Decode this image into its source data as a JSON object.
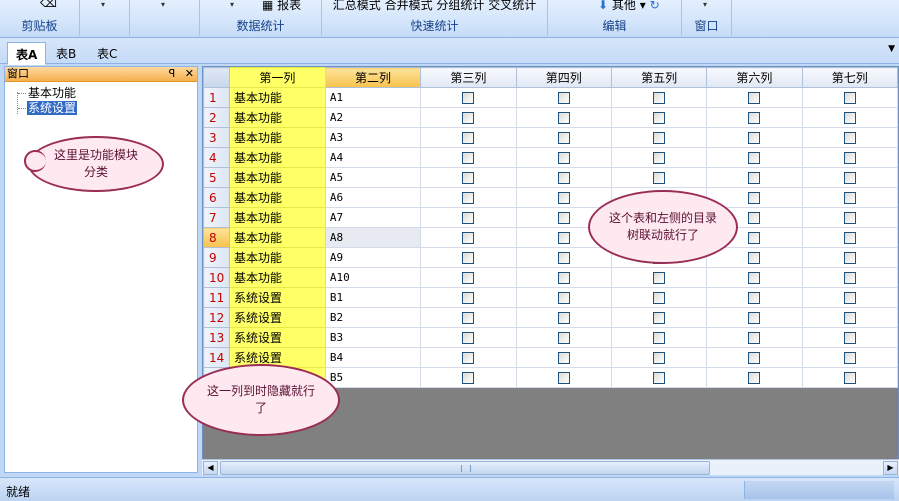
{
  "ribbon": {
    "groups": [
      {
        "label": "剪贴板",
        "top": ""
      },
      {
        "label": "",
        "top": ""
      },
      {
        "label": "",
        "top": ""
      },
      {
        "label": "数据统计",
        "top": "报表"
      },
      {
        "label": "快速统计",
        "top": "汇总模式 合并模式 分组统计 交叉统计"
      },
      {
        "label": "编辑",
        "top": "其他"
      },
      {
        "label": "窗口",
        "top": ""
      }
    ]
  },
  "tabs": [
    "表A",
    "表B",
    "表C"
  ],
  "panel": {
    "title": "窗口",
    "pin": "ᵖ",
    "close": "✕",
    "tree": [
      "基本功能",
      "系统设置"
    ]
  },
  "grid": {
    "columns": [
      "第一列",
      "第二列",
      "第三列",
      "第四列",
      "第五列",
      "第六列",
      "第七列"
    ],
    "rows": [
      {
        "n": "1",
        "c1": "基本功能",
        "c2": "A1"
      },
      {
        "n": "2",
        "c1": "基本功能",
        "c2": "A2"
      },
      {
        "n": "3",
        "c1": "基本功能",
        "c2": "A3"
      },
      {
        "n": "4",
        "c1": "基本功能",
        "c2": "A4"
      },
      {
        "n": "5",
        "c1": "基本功能",
        "c2": "A5"
      },
      {
        "n": "6",
        "c1": "基本功能",
        "c2": "A6"
      },
      {
        "n": "7",
        "c1": "基本功能",
        "c2": "A7"
      },
      {
        "n": "8",
        "c1": "基本功能",
        "c2": "A8"
      },
      {
        "n": "9",
        "c1": "基本功能",
        "c2": "A9"
      },
      {
        "n": "10",
        "c1": "基本功能",
        "c2": "A10"
      },
      {
        "n": "11",
        "c1": "系统设置",
        "c2": "B1"
      },
      {
        "n": "12",
        "c1": "系统设置",
        "c2": "B2"
      },
      {
        "n": "13",
        "c1": "系统设置",
        "c2": "B3"
      },
      {
        "n": "14",
        "c1": "系统设置",
        "c2": "B4"
      },
      {
        "n": "",
        "c1": "",
        "c2": "B5"
      }
    ],
    "current_row": 8
  },
  "callouts": {
    "tree_note": "这里是功能模块分类",
    "table_note": "这个表和左侧的目录树联动就行了",
    "column_note": "这一列到时隐藏就行了"
  },
  "status": {
    "text": "就绪"
  },
  "colors": {
    "highlight_column": "#ffff66",
    "callout_border": "#9a2d55",
    "row_number": "#c00000"
  }
}
